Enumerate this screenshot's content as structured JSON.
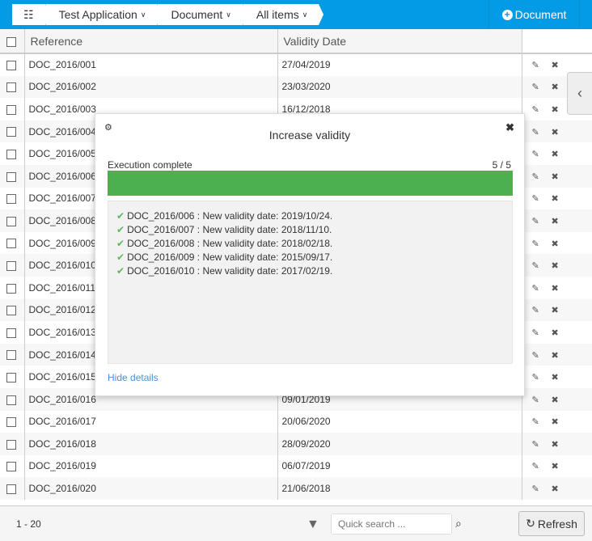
{
  "breadcrumb": {
    "items": [
      {
        "label": "Test Application"
      },
      {
        "label": "Document"
      },
      {
        "label": "All items"
      }
    ]
  },
  "header": {
    "new_button": "Document"
  },
  "table": {
    "columns": [
      "Reference",
      "Validity Date"
    ],
    "rows": [
      {
        "ref": "DOC_2016/001",
        "date": "27/04/2019"
      },
      {
        "ref": "DOC_2016/002",
        "date": "23/03/2020"
      },
      {
        "ref": "DOC_2016/003",
        "date": "16/12/2018"
      },
      {
        "ref": "DOC_2016/004",
        "date": ""
      },
      {
        "ref": "DOC_2016/005",
        "date": ""
      },
      {
        "ref": "DOC_2016/006",
        "date": ""
      },
      {
        "ref": "DOC_2016/007",
        "date": ""
      },
      {
        "ref": "DOC_2016/008",
        "date": ""
      },
      {
        "ref": "DOC_2016/009",
        "date": ""
      },
      {
        "ref": "DOC_2016/010",
        "date": ""
      },
      {
        "ref": "DOC_2016/011",
        "date": ""
      },
      {
        "ref": "DOC_2016/012",
        "date": ""
      },
      {
        "ref": "DOC_2016/013",
        "date": ""
      },
      {
        "ref": "DOC_2016/014",
        "date": ""
      },
      {
        "ref": "DOC_2016/015",
        "date": ""
      },
      {
        "ref": "DOC_2016/016",
        "date": "09/01/2019"
      },
      {
        "ref": "DOC_2016/017",
        "date": "20/06/2020"
      },
      {
        "ref": "DOC_2016/018",
        "date": "28/09/2020"
      },
      {
        "ref": "DOC_2016/019",
        "date": "06/07/2019"
      },
      {
        "ref": "DOC_2016/020",
        "date": "21/06/2018"
      }
    ]
  },
  "footer": {
    "count": "1 - 20",
    "search_placeholder": "Quick search ...",
    "refresh": "Refresh"
  },
  "dialog": {
    "title": "Increase validity",
    "status": "Execution complete",
    "progress_text": "5 / 5",
    "progress": 1.0,
    "progress_color": "#4caf50",
    "messages": [
      "DOC_2016/006 : New validity date: 2019/10/24.",
      "DOC_2016/007 : New validity date: 2018/11/10.",
      "DOC_2016/008 : New validity date: 2018/02/18.",
      "DOC_2016/009 : New validity date: 2015/09/17.",
      "DOC_2016/010 : New validity date: 2017/02/19."
    ],
    "hide_details": "Hide details"
  },
  "colors": {
    "accent": "#039be5"
  }
}
